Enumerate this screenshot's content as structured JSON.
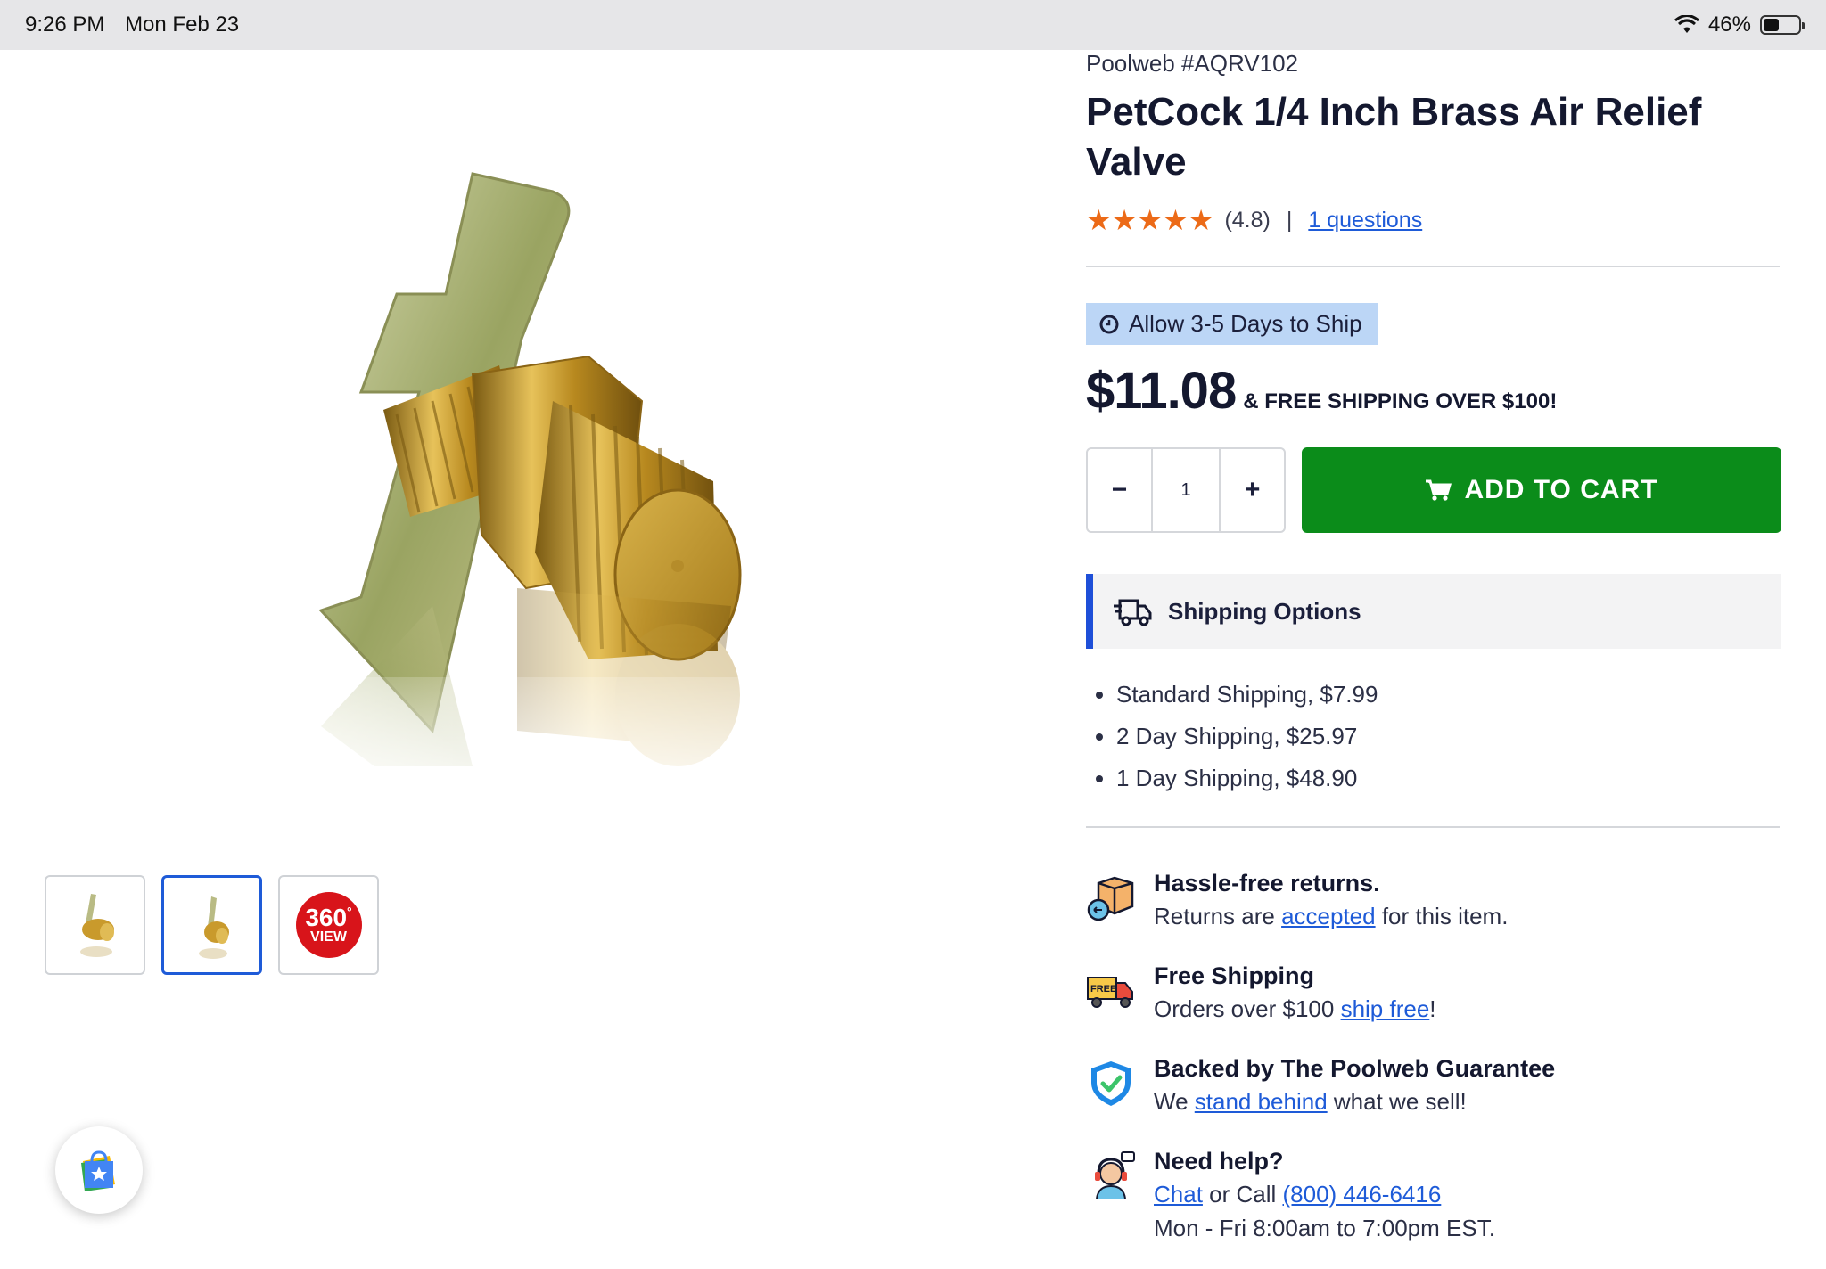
{
  "status_bar": {
    "time": "9:26 PM",
    "date": "Mon Feb 23",
    "battery": "46%"
  },
  "product": {
    "sku": "Poolweb #AQRV102",
    "title": "PetCock 1/4 Inch Brass Air Relief Valve",
    "rating": {
      "stars": 5,
      "value": "(4.8)",
      "separator": "|",
      "questions_link": "1 questions"
    },
    "ship_notice": "Allow 3-5 Days to Ship",
    "price": "$11.08",
    "free_shipping_note": "& FREE SHIPPING OVER $100!",
    "quantity": {
      "minus": "−",
      "value": "1",
      "plus": "+"
    },
    "add_to_cart": "ADD TO CART"
  },
  "thumbnails": {
    "badge_360_number": "360",
    "badge_360_degree": "°",
    "badge_360_label": "VIEW"
  },
  "shipping_options": {
    "title": "Shipping Options",
    "items": [
      "Standard Shipping, $7.99",
      "2 Day Shipping, $25.97",
      "1 Day Shipping, $48.90"
    ]
  },
  "features": {
    "returns": {
      "title": "Hassle-free returns.",
      "pre": "Returns are ",
      "link": "accepted",
      "post": " for this item."
    },
    "free_shipping": {
      "title": "Free Shipping",
      "pre": "Orders over $100 ",
      "link": "ship free",
      "post": "!",
      "icon_text": "FREE"
    },
    "guarantee": {
      "title": "Backed by The Poolweb Guarantee",
      "pre": "We ",
      "link": "stand behind",
      "post": " what we sell!"
    },
    "help": {
      "title": "Need help?",
      "chat": "Chat",
      "mid": " or Call ",
      "phone": "(800) 446-6416",
      "hours": "Mon - Fri 8:00am to 7:00pm EST."
    }
  },
  "colors": {
    "accent_blue": "#1e5bd8",
    "cart_green": "#0b8c1a",
    "star_orange": "#ec6a17",
    "pill_blue": "#bcd6f6"
  }
}
